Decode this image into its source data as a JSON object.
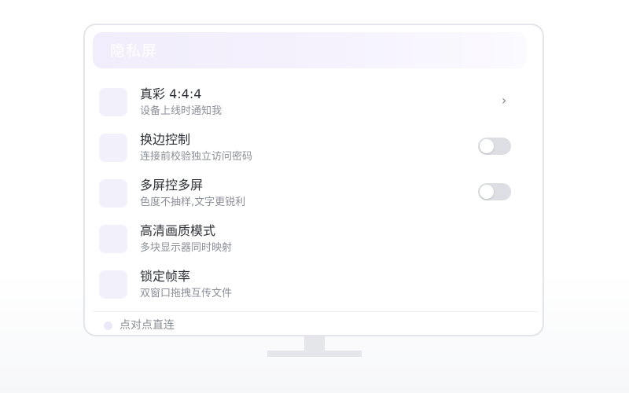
{
  "panel": {
    "title": "隐私屏"
  },
  "rows": [
    {
      "title": "真彩 4:4:4",
      "subtitle": "设备上线时通知我",
      "control": "chevron",
      "chevron_glyph": "›"
    },
    {
      "title": "换边控制",
      "subtitle": "连接前校验独立访问密码",
      "control": "toggle",
      "toggle_on": false
    },
    {
      "title": "多屏控多屏",
      "subtitle": "色度不抽样,文字更锐利",
      "control": "toggle",
      "toggle_on": false
    },
    {
      "title": "高清画质模式",
      "subtitle": "多块显示器同时映射",
      "control": "none"
    },
    {
      "title": "锁定帧率",
      "subtitle": "双窗口拖拽互传文件",
      "control": "none"
    }
  ],
  "footer": {
    "text": "点对点直连"
  },
  "colors": {
    "accent_light": "#f2f0fb",
    "toggle_off": "#dcdee3",
    "title_text": "#2e3038",
    "subtitle_text": "#8b8f98"
  }
}
